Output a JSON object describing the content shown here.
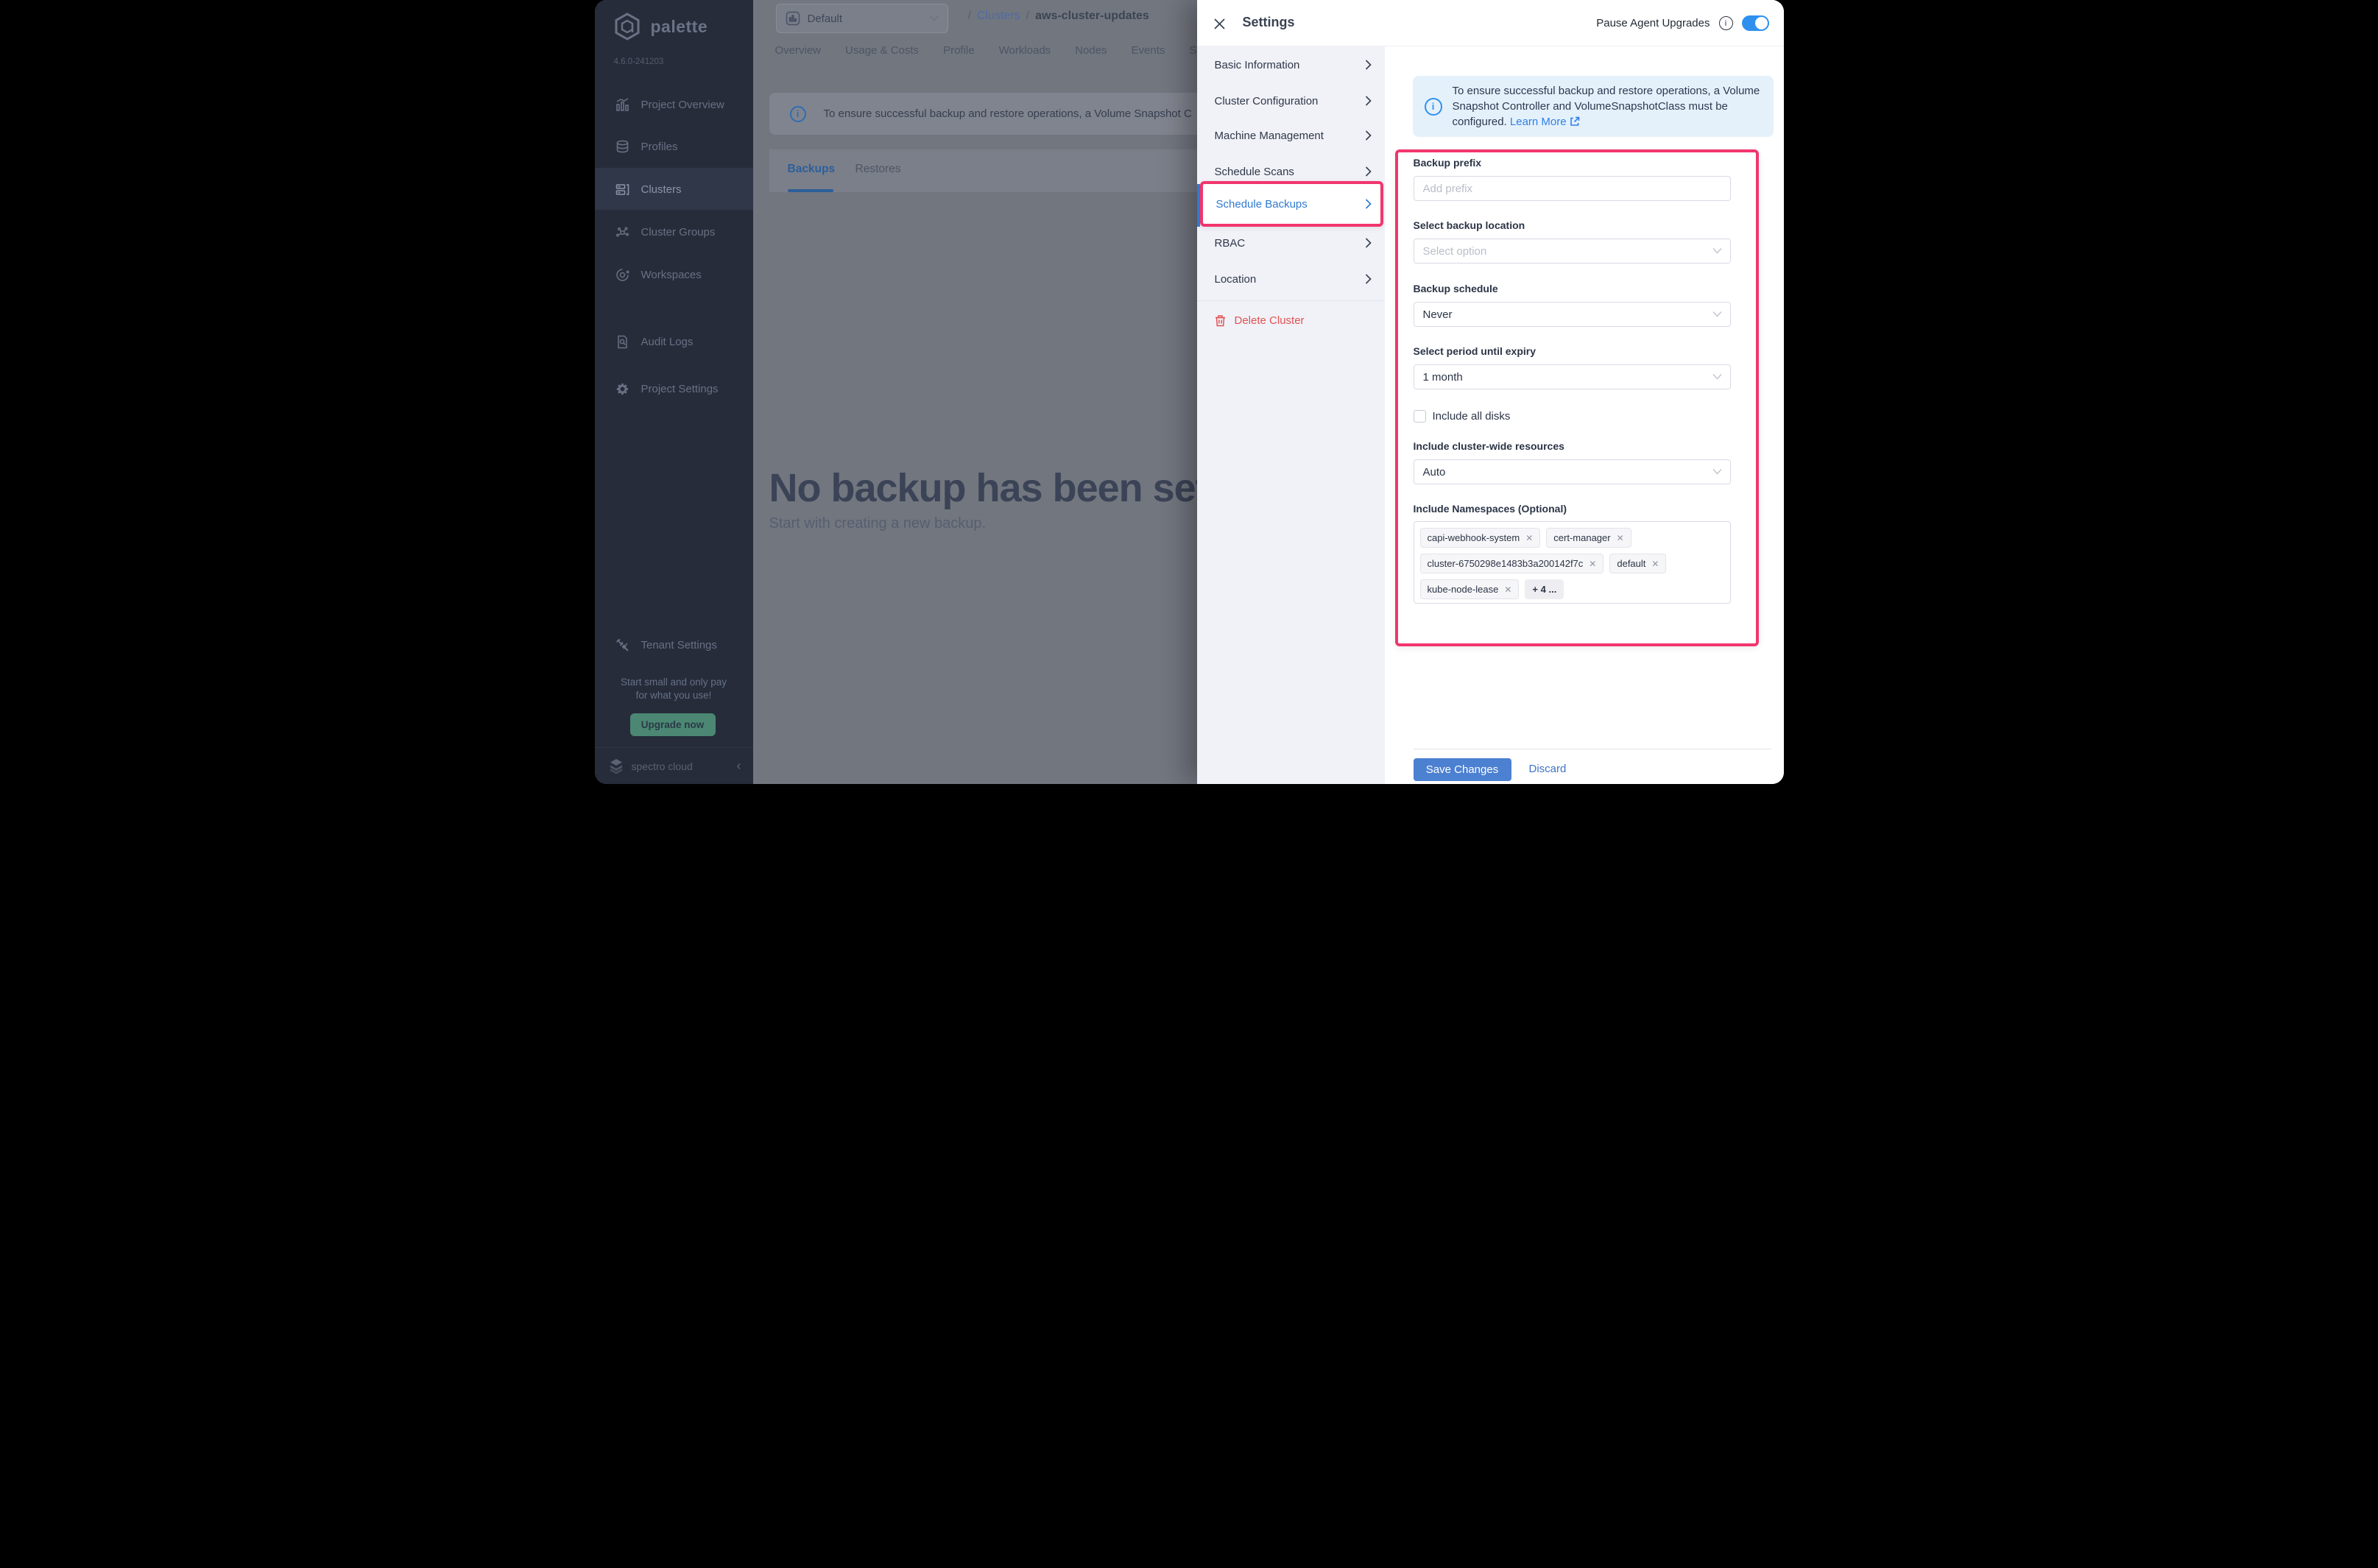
{
  "glyphs": {
    "close": "✕",
    "slash": "/",
    "collapse": "‹",
    "info": "i"
  },
  "sidebar": {
    "logo_text": "palette",
    "version": "4.6.0-241203",
    "items": [
      {
        "label": "Project Overview"
      },
      {
        "label": "Profiles"
      },
      {
        "label": "Clusters"
      },
      {
        "label": "Cluster Groups"
      },
      {
        "label": "Workspaces"
      },
      {
        "label": "Audit Logs"
      },
      {
        "label": "Project Settings"
      }
    ],
    "tenant_settings_label": "Tenant Settings",
    "promo_line1": "Start small and only pay",
    "promo_line2": "for what you use!",
    "upgrade_button_label": "Upgrade now",
    "brand_footer": "spectro cloud"
  },
  "topbar": {
    "project_selector_value": "Default",
    "breadcrumb": {
      "link": "Clusters",
      "current": "aws-cluster-updates"
    },
    "tabs": [
      "Overview",
      "Usage & Costs",
      "Profile",
      "Workloads",
      "Nodes",
      "Events",
      "S"
    ]
  },
  "main": {
    "banner_text": "To ensure successful backup and restore operations, a Volume Snapshot C",
    "subtabs": [
      "Backups",
      "Restores"
    ],
    "empty_title": "No backup has been set up y",
    "empty_subtitle": "Start with creating a new backup."
  },
  "drawer": {
    "title": "Settings",
    "pause_agent_label": "Pause Agent Upgrades",
    "nav": [
      "Basic Information",
      "Cluster Configuration",
      "Machine Management",
      "Schedule Scans",
      "Schedule Backups",
      "RBAC",
      "Location"
    ],
    "delete_label": "Delete Cluster",
    "info_text": "To ensure successful backup and restore operations, a Volume Snapshot Controller and VolumeSnapshotClass must be configured.",
    "learn_more_label": "Learn More",
    "form": {
      "backup_prefix_label": "Backup prefix",
      "backup_prefix_placeholder": "Add prefix",
      "backup_location_label": "Select backup location",
      "backup_location_placeholder": "Select option",
      "backup_schedule_label": "Backup schedule",
      "backup_schedule_value": "Never",
      "expiry_label": "Select period until expiry",
      "expiry_value": "1 month",
      "include_all_disks_label": "Include all disks",
      "cluster_wide_label": "Include cluster-wide resources",
      "cluster_wide_value": "Auto",
      "namespaces_label": "Include Namespaces (Optional)",
      "namespace_tags": [
        "capi-webhook-system",
        "cert-manager",
        "cluster-6750298e1483b3a200142f7c",
        "default",
        "kube-node-lease"
      ],
      "more_tag": "+ 4 ...",
      "save_label": "Save Changes",
      "discard_label": "Discard"
    },
    "colors": {
      "highlight_pink": "#f1356d",
      "accent_blue": "#2f7ad0",
      "toggle_on": "#2e90ee",
      "save_blue": "#4c80d1",
      "delete_red": "#e05252",
      "info_banner_bg": "#e4f1fb"
    }
  }
}
